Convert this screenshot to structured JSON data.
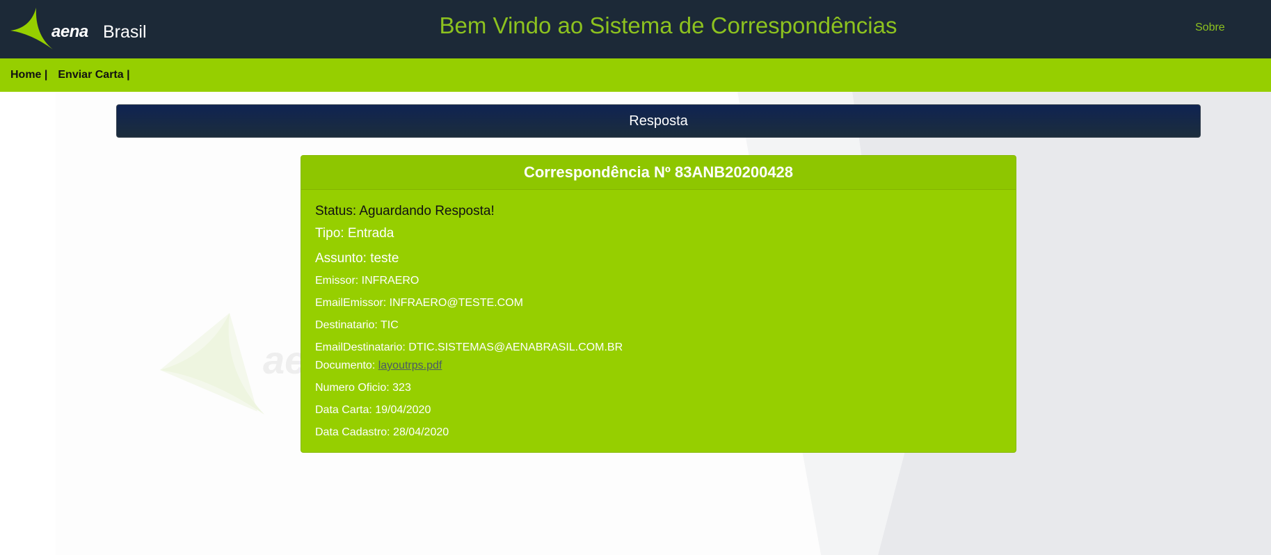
{
  "header": {
    "logo_brand": "aena",
    "logo_country": "Brasil",
    "title": "Bem Vindo ao Sistema de Correspondências",
    "about_link": "Sobre"
  },
  "nav": {
    "items": [
      {
        "label": "Home |"
      },
      {
        "label": "Enviar Carta |"
      }
    ]
  },
  "section": {
    "title": "Resposta"
  },
  "card": {
    "title": "Correspondência Nº 83ANB20200428",
    "status": "Status: Aguardando Resposta!",
    "tipo": "Tipo: Entrada",
    "assunto": "Assunto: teste",
    "emissor": "Emissor: INFRAERO",
    "email_emissor": "EmailEmissor: INFRAERO@TESTE.COM",
    "destinatario": "Destinatario: TIC",
    "email_destinatario": "EmailDestinatario: DTIC.SISTEMAS@AENABRASIL.COM.BR",
    "documento_label": "Documento: ",
    "documento_link": "layoutrps.pdf",
    "numero_oficio": "Numero Oficio: 323",
    "data_carta": "Data Carta: 19/04/2020",
    "data_cadastro": "Data Cadastro: 28/04/2020"
  },
  "colors": {
    "header_bg": "#1c2937",
    "accent_green": "#96cf00",
    "title_green": "#8dc21f",
    "resposta_bar": "#0f2352"
  }
}
